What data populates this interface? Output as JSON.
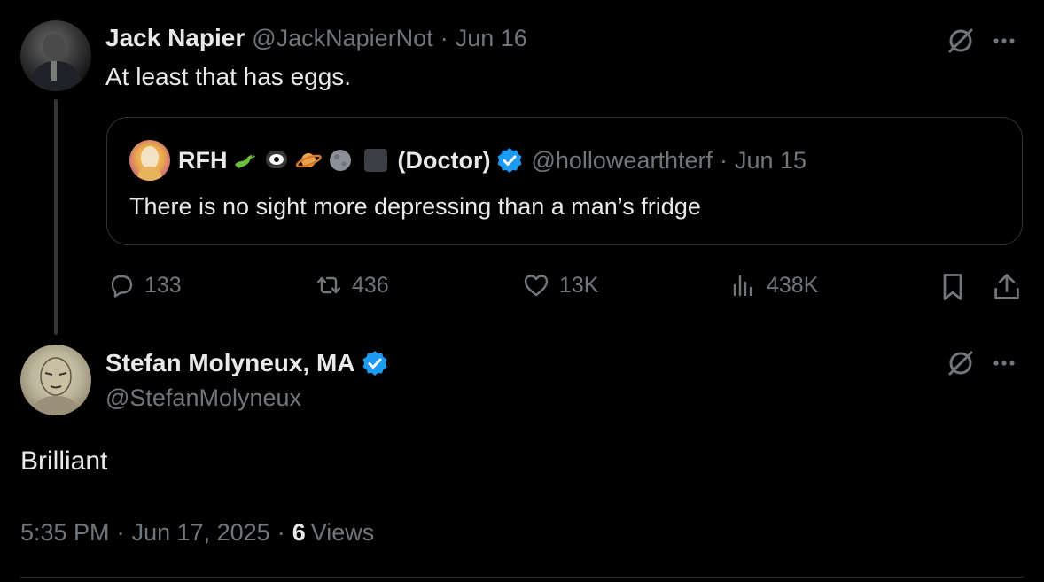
{
  "parent_tweet": {
    "author_name": "Jack Napier",
    "handle": "@JackNapierNot",
    "separator": "·",
    "date": "Jun 16",
    "text": "At least that has eggs.",
    "quoted": {
      "author_name_prefix": "RFH",
      "author_name_suffix": "(Doctor)",
      "handle": "@hollowearthterf",
      "separator": "·",
      "date": "Jun 15",
      "text": "There is no sight more depressing than a man’s fridge"
    },
    "actions": {
      "replies": "133",
      "reposts": "436",
      "likes": "13K",
      "views": "438K"
    }
  },
  "main_tweet": {
    "author_name": "Stefan Molyneux, MA",
    "handle": "@StefanMolyneux",
    "text": "Brilliant",
    "time": "5:35 PM",
    "separator": "·",
    "date": "Jun 17, 2025",
    "separator2": "·",
    "views_count": "6",
    "views_label": "Views"
  },
  "colors": {
    "background": "#000000",
    "text_primary": "#e7e9ea",
    "text_muted": "#71767b",
    "border": "#2f3336",
    "verified_blue": "#1d9bf0"
  },
  "icons": {
    "grok": "grok-icon",
    "more": "more-icon",
    "reply": "reply-icon",
    "repost": "repost-icon",
    "like": "heart-icon",
    "views": "views-icon",
    "bookmark": "bookmark-icon",
    "share": "share-icon",
    "verified": "verified-badge-icon"
  }
}
